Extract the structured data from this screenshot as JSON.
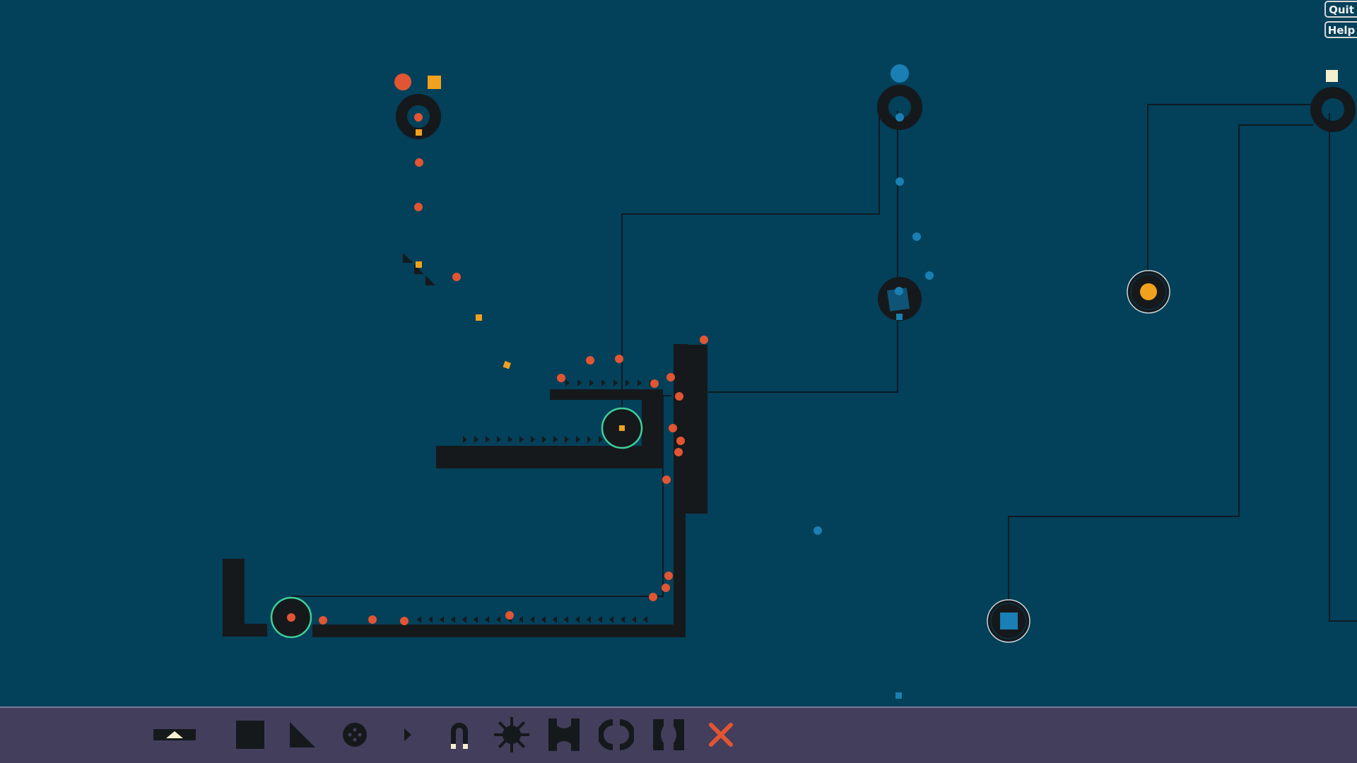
{
  "game": {
    "ui_buttons": {
      "quit_label": "Quit",
      "help_label": "Help"
    },
    "colors": {
      "background": "#03405a",
      "wall": "#16191c",
      "orange_ball": "#e25532",
      "yellow_square": "#f0a21e",
      "blue_ball": "#1a7fb4",
      "white_square": "#f4f0d0",
      "glow_ring": "#3ecf9a",
      "toolbar": "#433e5c",
      "delete_x": "#e25532"
    },
    "emitters": [
      "orange-ball-and-square-emitter",
      "blue-ball-emitter",
      "white-square-emitter"
    ],
    "receivers": [
      "yellow-ball-receiver",
      "blue-square-receiver"
    ]
  },
  "toolbar": {
    "tools": [
      {
        "name": "collapse-toolbar-icon"
      },
      {
        "name": "block-tool-icon"
      },
      {
        "name": "ramp-tool-icon"
      },
      {
        "name": "splitter-tool-icon"
      },
      {
        "name": "conveyor-tool-icon"
      },
      {
        "name": "magnet-tool-icon"
      },
      {
        "name": "spinner-tool-icon"
      },
      {
        "name": "funnel-tool-icon"
      },
      {
        "name": "bracket-tool-icon"
      },
      {
        "name": "reverse-bracket-tool-icon"
      },
      {
        "name": "delete-tool-icon"
      }
    ]
  }
}
